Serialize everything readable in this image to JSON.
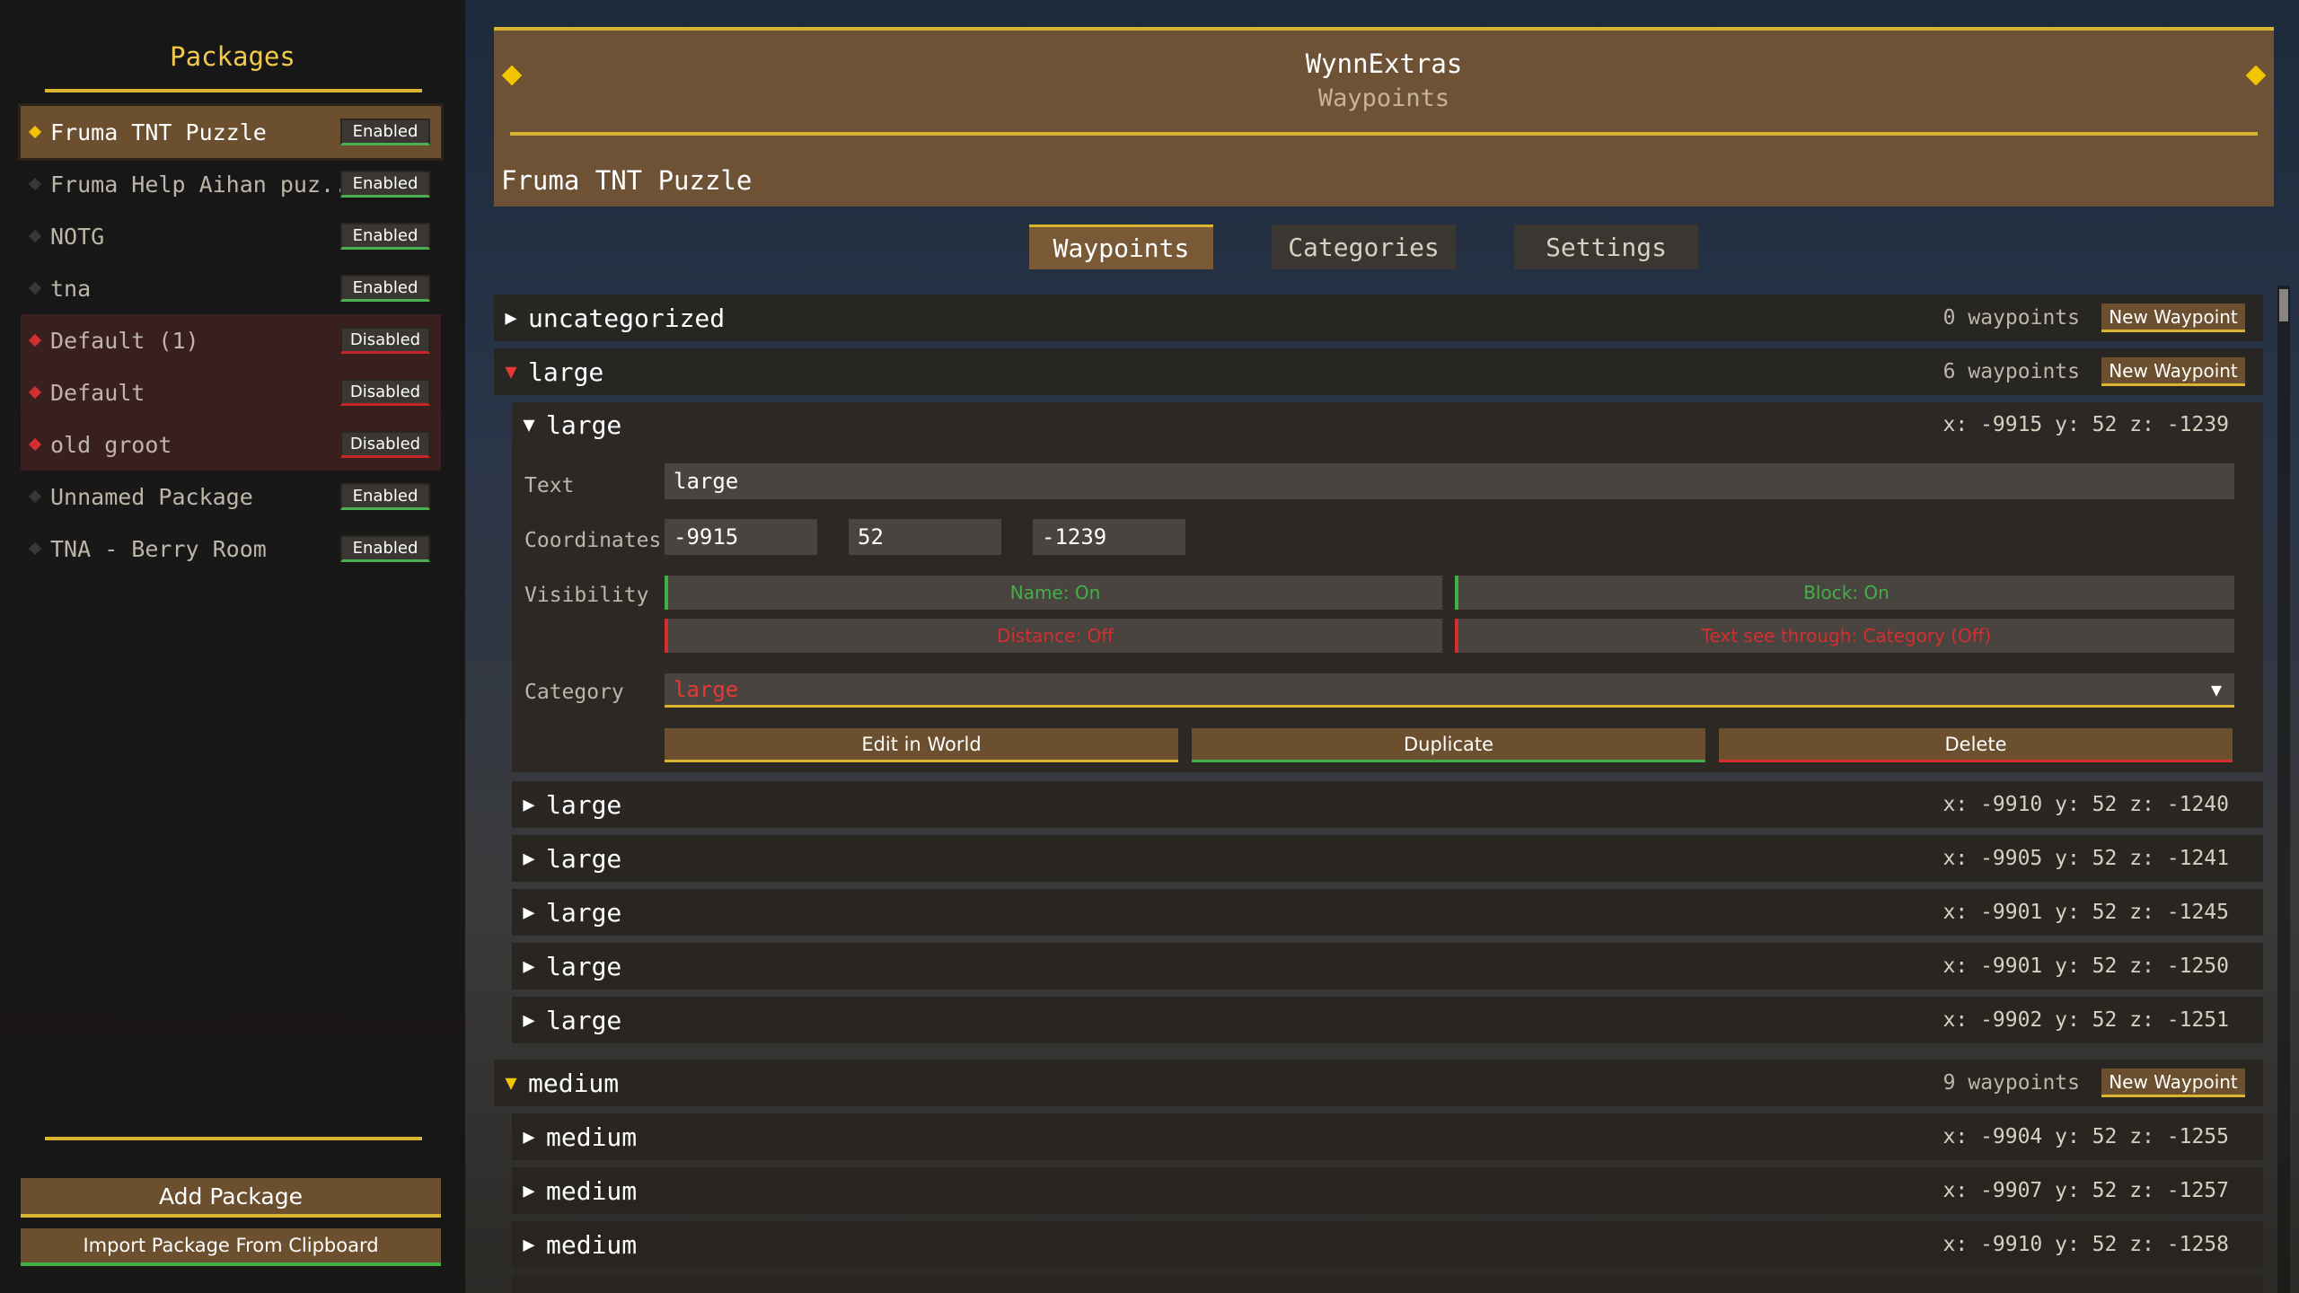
{
  "sidebar": {
    "title": "Packages",
    "packages": [
      {
        "name": "Fruma TNT Puzzle",
        "status": "Enabled"
      },
      {
        "name": "Fruma Help Aihan puz...",
        "status": "Enabled"
      },
      {
        "name": "NOTG",
        "status": "Enabled"
      },
      {
        "name": "tna",
        "status": "Enabled"
      },
      {
        "name": "Default (1)",
        "status": "Disabled"
      },
      {
        "name": "Default",
        "status": "Disabled"
      },
      {
        "name": "old groot",
        "status": "Disabled"
      },
      {
        "name": "Unnamed Package",
        "status": "Enabled"
      },
      {
        "name": "TNA - Berry Room",
        "status": "Enabled"
      }
    ],
    "add_package": "Add Package",
    "import_package": "Import Package From Clipboard"
  },
  "header": {
    "title": "WynnExtras",
    "subtitle": "Waypoints",
    "package_name": "Fruma TNT Puzzle"
  },
  "tabs": [
    "Waypoints",
    "Categories",
    "Settings"
  ],
  "new_waypoint_label": "New Waypoint",
  "categories": [
    {
      "name": "uncategorized",
      "count": "0 waypoints"
    },
    {
      "name": "large",
      "count": "6 waypoints"
    },
    {
      "name": "medium",
      "count": "9 waypoints"
    }
  ],
  "editor": {
    "title": "large",
    "coords_text": "x: -9915 y: 52 z: -1239",
    "text_label": "Text",
    "text_value": "large",
    "coords_label": "Coordinates",
    "x": "-9915",
    "y": "52",
    "z": "-1239",
    "visibility_label": "Visibility",
    "name_toggle": "Name: On",
    "block_toggle": "Block: On",
    "distance_toggle": "Distance: Off",
    "see_through_toggle": "Text see through: Category (Off)",
    "category_label": "Category",
    "category_value": "large",
    "edit_in_world": "Edit in World",
    "duplicate": "Duplicate",
    "delete": "Delete"
  },
  "large_waypoints": [
    {
      "name": "large",
      "coords": "x: -9910 y: 52 z: -1240"
    },
    {
      "name": "large",
      "coords": "x: -9905 y: 52 z: -1241"
    },
    {
      "name": "large",
      "coords": "x: -9901 y: 52 z: -1245"
    },
    {
      "name": "large",
      "coords": "x: -9901 y: 52 z: -1250"
    },
    {
      "name": "large",
      "coords": "x: -9902 y: 52 z: -1251"
    }
  ],
  "medium_waypoints": [
    {
      "name": "medium",
      "coords": "x: -9904 y: 52 z: -1255"
    },
    {
      "name": "medium",
      "coords": "x: -9907 y: 52 z: -1257"
    },
    {
      "name": "medium",
      "coords": "x: -9910 y: 52 z: -1258"
    }
  ],
  "colors": {
    "accent_gold": "#d9b431",
    "enabled_green": "#43b047",
    "disabled_red": "#d32f2f",
    "panel_brown": "#6e5235"
  }
}
